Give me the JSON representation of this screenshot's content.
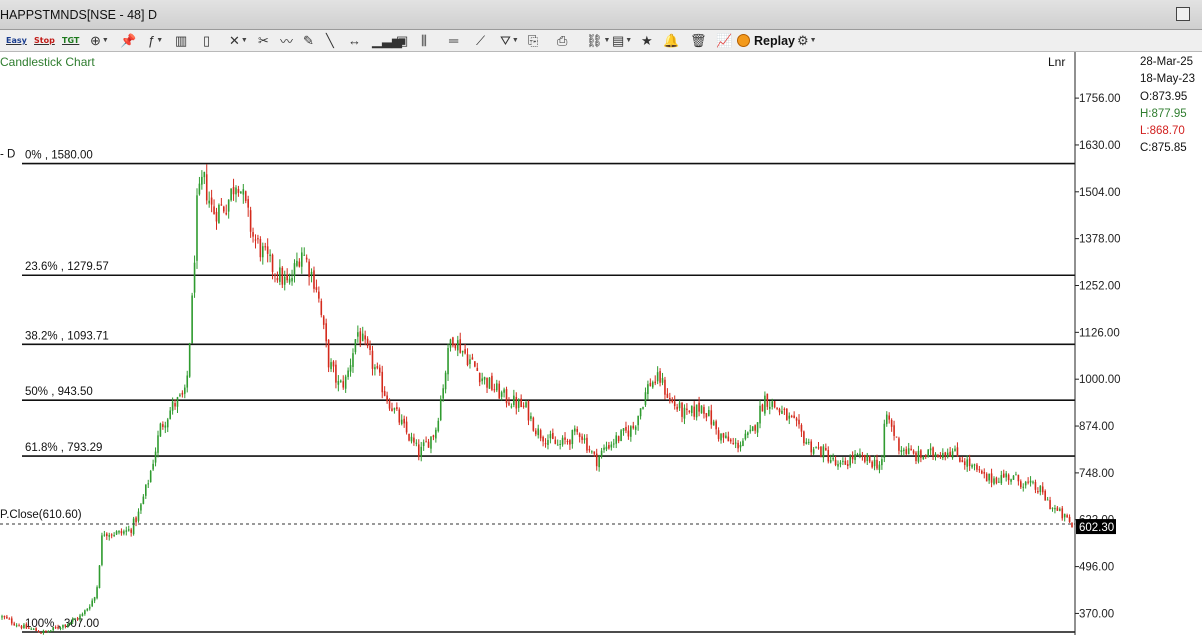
{
  "window": {
    "title": "HAPPSTMNDS[NSE - 48] D"
  },
  "toolbar": {
    "items": [
      {
        "name": "easy-tag-button",
        "text": "Easy",
        "color": "#1a3d8f"
      },
      {
        "name": "stop-tag-button",
        "text": "Stop",
        "color": "#c11b17"
      },
      {
        "name": "tgt-tag-button",
        "text": "TGT",
        "color": "#1e7a1e"
      },
      {
        "name": "crosshair-tool-icon",
        "text": "⊕",
        "dropdown": true
      },
      {
        "name": "pin-tool-icon",
        "text": "📌"
      },
      {
        "name": "indicator-menu-icon",
        "text": "ƒ",
        "dropdown": true
      },
      {
        "name": "bar-chart-icon",
        "text": "▥"
      },
      {
        "name": "candle-chart-icon",
        "text": "▯"
      },
      {
        "name": "draw-lines-icon",
        "text": "✕",
        "dropdown": true
      },
      {
        "name": "scissors-icon",
        "text": "✂"
      },
      {
        "name": "freehand-icon",
        "text": "〰"
      },
      {
        "name": "pencil-icon",
        "text": "✎"
      },
      {
        "name": "trendline-icon",
        "text": "╲"
      },
      {
        "name": "horizontal-ray-icon",
        "text": "↔"
      },
      {
        "name": "volume-bars-icon",
        "text": "▁▃▅"
      },
      {
        "name": "cube-icon",
        "text": "▣"
      },
      {
        "name": "columns-icon",
        "text": "⫼"
      },
      {
        "name": "equal-lines-icon",
        "text": "═"
      },
      {
        "name": "ruler-icon",
        "text": "⟋"
      },
      {
        "name": "bucket-icon",
        "text": "⛛",
        "dropdown": true
      },
      {
        "name": "document-export-icon",
        "text": "⎘"
      },
      {
        "name": "print-icon",
        "text": "⎙"
      },
      {
        "name": "chain-link-icon",
        "text": "⛓",
        "dropdown": true
      },
      {
        "name": "layout-icon",
        "text": "▤",
        "dropdown": true
      },
      {
        "name": "favorite-star-icon",
        "text": "★"
      },
      {
        "name": "alert-bell-icon",
        "text": "🔔"
      },
      {
        "name": "delete-bin-icon",
        "text": "🗑"
      },
      {
        "name": "compare-chart-icon",
        "text": "📈"
      }
    ],
    "replay_label": "Replay",
    "settings_icon": "gear-icon"
  },
  "chart_labels": {
    "chart_type": "Candlestick Chart",
    "scale": "Lnr",
    "fib_side_marker": "- D",
    "prev_close_label": "P.Close(610.60)",
    "last_price_tag": "602.30",
    "obscured_axis_tick": "622.00"
  },
  "ohlc_panel": {
    "to_date": "28-Mar-25",
    "from_date": "18-May-23",
    "open": "O:873.95",
    "high": "H:877.95",
    "low": "L:868.70",
    "close": "C:875.85"
  },
  "colors": {
    "up": "#2f9b2f",
    "down": "#d42a1c",
    "fib_line": "#111111",
    "axis_text": "#222222",
    "last_price_bg": "#000000",
    "green_text": "#2f7d2f",
    "red_text": "#d1201f"
  },
  "chart_data": {
    "type": "candlestick",
    "title": "",
    "symbol": "HAPPSTMNDS",
    "exchange": "NSE",
    "timeframe": "D",
    "scale": "linear",
    "date_range": [
      "18-May-23",
      "28-Mar-25"
    ],
    "y_ticks": [
      370,
      496,
      622,
      748,
      874,
      1000,
      1126,
      1252,
      1378,
      1504,
      1630,
      1756
    ],
    "y_tick_labels": [
      "370.00",
      "496.00",
      "622.00",
      "748.00",
      "874.00",
      "1000.00",
      "1126.00",
      "1252.00",
      "1378.00",
      "1504.00",
      "1630.00",
      "1756.00"
    ],
    "y_range": [
      312,
      1880
    ],
    "fibonacci_retracement": [
      {
        "label": "0%  , 1580.00",
        "level": 1580.0
      },
      {
        "label": "23.6%  , 1279.57",
        "level": 1279.57
      },
      {
        "label": "38.2%  , 1093.71",
        "level": 1093.71
      },
      {
        "label": "50%  , 943.50",
        "level": 943.5
      },
      {
        "label": "61.8%  , 793.29",
        "level": 793.29
      },
      {
        "label": "100%  , 307.00",
        "level": 307.0
      }
    ],
    "previous_close": 610.6,
    "last_price": 602.3,
    "price_path_anchors": [
      [
        0,
        360
      ],
      [
        0.02,
        333
      ],
      [
        0.04,
        318
      ],
      [
        0.06,
        342
      ],
      [
        0.075,
        365
      ],
      [
        0.088,
        420
      ],
      [
        0.094,
        590
      ],
      [
        0.11,
        585
      ],
      [
        0.12,
        595
      ],
      [
        0.128,
        640
      ],
      [
        0.138,
        740
      ],
      [
        0.148,
        870
      ],
      [
        0.16,
        930
      ],
      [
        0.172,
        960
      ],
      [
        0.178,
        1220
      ],
      [
        0.182,
        1460
      ],
      [
        0.188,
        1540
      ],
      [
        0.197,
        1450
      ],
      [
        0.21,
        1470
      ],
      [
        0.22,
        1545
      ],
      [
        0.235,
        1380
      ],
      [
        0.25,
        1310
      ],
      [
        0.268,
        1250
      ],
      [
        0.28,
        1350
      ],
      [
        0.294,
        1250
      ],
      [
        0.305,
        1050
      ],
      [
        0.315,
        980
      ],
      [
        0.322,
        1000
      ],
      [
        0.332,
        1130
      ],
      [
        0.345,
        1050
      ],
      [
        0.36,
        950
      ],
      [
        0.375,
        870
      ],
      [
        0.39,
        800
      ],
      [
        0.405,
        860
      ],
      [
        0.42,
        1120
      ],
      [
        0.435,
        1060
      ],
      [
        0.45,
        1000
      ],
      [
        0.47,
        950
      ],
      [
        0.49,
        920
      ],
      [
        0.5,
        860
      ],
      [
        0.52,
        820
      ],
      [
        0.54,
        860
      ],
      [
        0.555,
        780
      ],
      [
        0.565,
        820
      ],
      [
        0.59,
        870
      ],
      [
        0.605,
        990
      ],
      [
        0.615,
        1000
      ],
      [
        0.625,
        940
      ],
      [
        0.64,
        900
      ],
      [
        0.655,
        930
      ],
      [
        0.67,
        850
      ],
      [
        0.685,
        820
      ],
      [
        0.7,
        850
      ],
      [
        0.713,
        950
      ],
      [
        0.725,
        920
      ],
      [
        0.74,
        880
      ],
      [
        0.755,
        820
      ],
      [
        0.77,
        800
      ],
      [
        0.782,
        760
      ],
      [
        0.795,
        790
      ],
      [
        0.81,
        780
      ],
      [
        0.822,
        770
      ],
      [
        0.826,
        910
      ],
      [
        0.838,
        820
      ],
      [
        0.855,
        790
      ],
      [
        0.87,
        800
      ],
      [
        0.885,
        810
      ],
      [
        0.9,
        780
      ],
      [
        0.92,
        730
      ],
      [
        0.94,
        740
      ],
      [
        0.96,
        715
      ],
      [
        0.97,
        700
      ],
      [
        0.98,
        660
      ],
      [
        1.0,
        610
      ]
    ]
  }
}
